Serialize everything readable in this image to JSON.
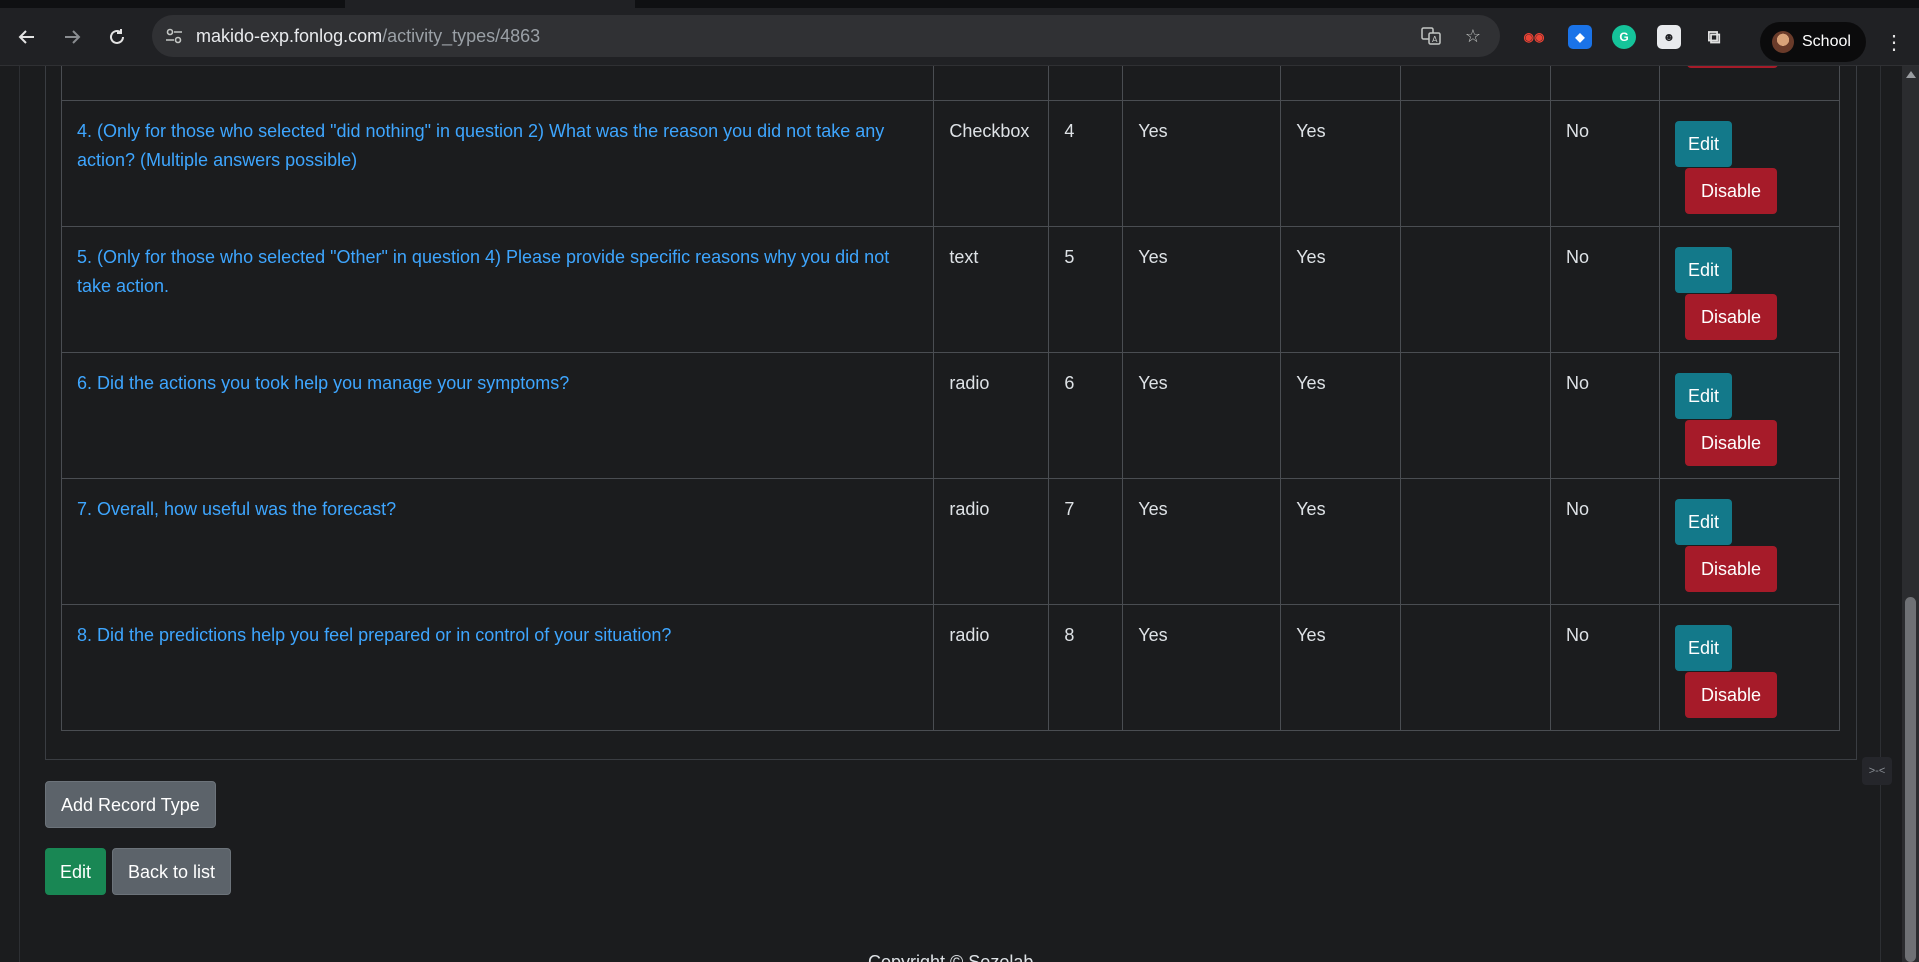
{
  "browser": {
    "url_host": "makido-exp.fonlog.com",
    "url_path": "/activity_types/4863",
    "profile_name": "School",
    "back_icon": "arrow-left-icon",
    "forward_icon": "arrow-right-icon",
    "reload_icon": "reload-icon"
  },
  "table": {
    "rows": [
      {
        "question": "4. (Only for those who selected \"did nothing\" in question 2) What was the reason you did not take any action? (Multiple answers possible)",
        "type": "Checkbox",
        "order": "4",
        "col4": "Yes",
        "col5": "Yes",
        "col6": "",
        "col7": "No",
        "edit_label": "Edit",
        "disable_label": "Disable"
      },
      {
        "question": "5. (Only for those who selected \"Other\" in question 4) Please provide specific reasons why you did not take action.",
        "type": "text",
        "order": "5",
        "col4": "Yes",
        "col5": "Yes",
        "col6": "",
        "col7": "No",
        "edit_label": "Edit",
        "disable_label": "Disable"
      },
      {
        "question": "6. Did the actions you took help you manage your symptoms?",
        "type": "radio",
        "order": "6",
        "col4": "Yes",
        "col5": "Yes",
        "col6": "",
        "col7": "No",
        "edit_label": "Edit",
        "disable_label": "Disable"
      },
      {
        "question": "7. Overall, how useful was the forecast?",
        "type": "radio",
        "order": "7",
        "col4": "Yes",
        "col5": "Yes",
        "col6": "",
        "col7": "No",
        "edit_label": "Edit",
        "disable_label": "Disable"
      },
      {
        "question": "8. Did the predictions help you feel prepared or in control of your situation?",
        "type": "radio",
        "order": "8",
        "col4": "Yes",
        "col5": "Yes",
        "col6": "",
        "col7": "No",
        "edit_label": "Edit",
        "disable_label": "Disable"
      }
    ]
  },
  "buttons": {
    "add_record_type": "Add Record Type",
    "edit": "Edit",
    "back_to_list": "Back to list"
  },
  "footer": {
    "copyright": "Copyright © Sozolab"
  },
  "colors": {
    "link": "#3ea6ff",
    "edit_row": "#13798a",
    "disable": "#a61b29",
    "edit_main": "#198754",
    "secondary": "#5c636a"
  }
}
